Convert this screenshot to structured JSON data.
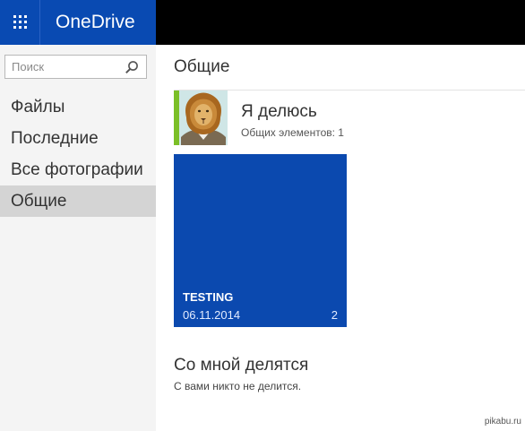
{
  "header": {
    "app_launcher_icon": "app-launcher-waffle-icon",
    "brand": "OneDrive"
  },
  "sidebar": {
    "search": {
      "placeholder": "Поиск",
      "icon": "search-icon"
    },
    "items": [
      {
        "label": "Файлы",
        "active": false
      },
      {
        "label": "Последние",
        "active": false
      },
      {
        "label": "Все фотографии",
        "active": false
      },
      {
        "label": "Общие",
        "active": true
      }
    ]
  },
  "main": {
    "title": "Общие",
    "shared_by_me": {
      "name": "Я делюсь",
      "count_text": "Общих элементов: 1",
      "avatar": "lion-avatar",
      "stripe_color": "#7bbf27"
    },
    "tile": {
      "title": "TESTING",
      "date": "06.11.2014",
      "count": "2",
      "color": "#0b49af"
    },
    "shared_with_me": {
      "heading": "Со мной делятся",
      "empty_text": "С вами никто не делится."
    }
  },
  "watermark": "pikabu.ru",
  "colors": {
    "brand_blue": "#094ab2",
    "topbar": "#000000",
    "sidebar_bg": "#f4f4f4",
    "active_item_bg": "#d4d4d4"
  }
}
